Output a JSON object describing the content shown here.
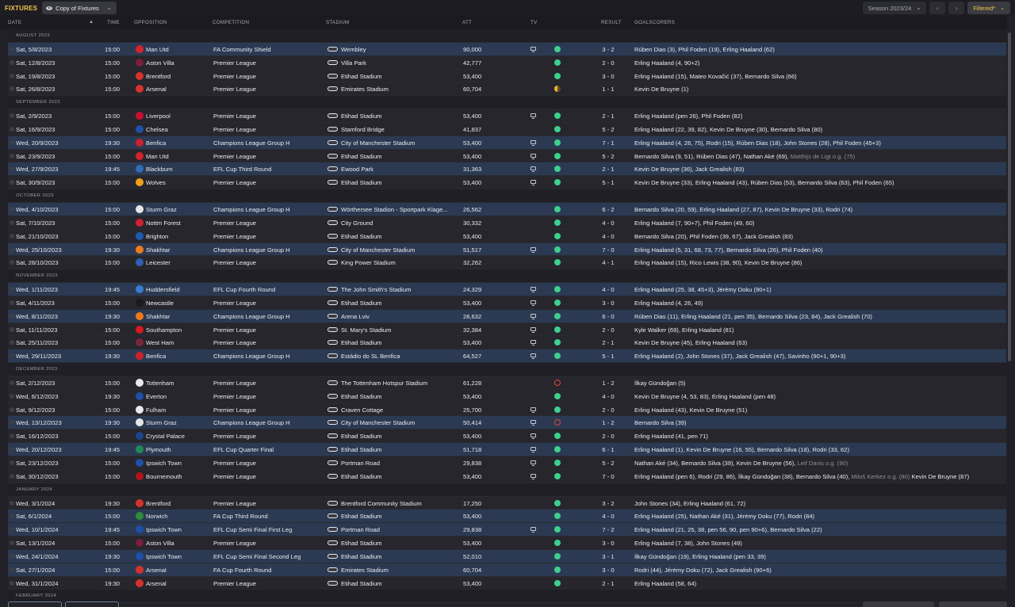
{
  "header": {
    "title": "FIXTURES",
    "view_label": "Copy of Fixtures",
    "season_label": "Season 2023/24",
    "filter_label": "Filtered*",
    "prev_icon": "chevron-left-icon",
    "next_icon": "chevron-right-icon"
  },
  "columns": {
    "date": "DATE",
    "time": "TIME",
    "opposition": "OPPOSITION",
    "competition": "COMPETITION",
    "stadium": "STADIUM",
    "att": "ATT",
    "tv": "TV",
    "result": "RESULT",
    "goalscorers": "GOALSCORERS"
  },
  "colors": {
    "accent": "#f2c744",
    "win": "#3ecf8e",
    "draw": "#f2b134",
    "loss": "#e0463e",
    "highlight_row": "#2b3a52"
  },
  "rows": [
    {
      "type": "month",
      "label": "AUGUST 2023"
    },
    {
      "type": "fixture",
      "date": "Sat, 5/8/2023",
      "time": "15:00",
      "opp": "Man Utd",
      "badge": "#d3242d",
      "comp": "FA Community Shield",
      "stadium": "Wembley",
      "att": "90,000",
      "tv": true,
      "status": "win",
      "result": "3 - 2",
      "scorers": "Rúben Dias (3), Phil Foden (19), Erling Haaland (62)",
      "hl": true
    },
    {
      "type": "fixture",
      "date": "Sat, 12/8/2023",
      "time": "15:00",
      "opp": "Aston Villa",
      "badge": "#7a1e3c",
      "comp": "Premier League",
      "stadium": "Villa Park",
      "att": "42,777",
      "tv": false,
      "status": "win",
      "result": "2 - 0",
      "scorers": "Erling Haaland (4, 90+2)"
    },
    {
      "type": "fixture",
      "date": "Sat, 19/8/2023",
      "time": "15:00",
      "opp": "Brentford",
      "badge": "#d6322c",
      "comp": "Premier League",
      "stadium": "Etihad Stadium",
      "att": "53,400",
      "tv": false,
      "status": "win",
      "result": "3 - 0",
      "scorers": "Erling Haaland (15), Mateo Kovačić (37), Bernardo Silva (66)"
    },
    {
      "type": "fixture",
      "date": "Sat, 26/8/2023",
      "time": "15:00",
      "opp": "Arsenal",
      "badge": "#d6322c",
      "comp": "Premier League",
      "stadium": "Emirates Stadium",
      "att": "60,704",
      "tv": false,
      "status": "draw",
      "result": "1 - 1",
      "scorers": "Kevin De Bruyne (1)"
    },
    {
      "type": "month",
      "label": "SEPTEMBER 2023"
    },
    {
      "type": "fixture",
      "date": "Sat, 2/9/2023",
      "time": "15:00",
      "opp": "Liverpool",
      "badge": "#c8102e",
      "comp": "Premier League",
      "stadium": "Etihad Stadium",
      "att": "53,400",
      "tv": true,
      "status": "win",
      "result": "2 - 1",
      "scorers": "Erling Haaland (pen 26), Phil Foden (82)"
    },
    {
      "type": "fixture",
      "date": "Sat, 16/9/2023",
      "time": "15:00",
      "opp": "Chelsea",
      "badge": "#1f4fa8",
      "comp": "Premier League",
      "stadium": "Stamford Bridge",
      "att": "41,837",
      "tv": false,
      "status": "win",
      "result": "5 - 2",
      "scorers": "Erling Haaland (22, 39, 82), Kevin De Bruyne (30), Bernardo Silva (80)"
    },
    {
      "type": "fixture",
      "date": "Wed, 20/9/2023",
      "time": "19:30",
      "opp": "Benfica",
      "badge": "#d0202e",
      "comp": "Champions League Group H",
      "stadium": "City of Manchester Stadium",
      "att": "53,400",
      "tv": true,
      "status": "win",
      "result": "7 - 1",
      "scorers": "Erling Haaland (4, 26, 75), Rodri (15), Rúben Dias (18), John Stones (28), Phil Foden (45+3)",
      "hl": true
    },
    {
      "type": "fixture",
      "date": "Sat, 23/9/2023",
      "time": "15:00",
      "opp": "Man Utd",
      "badge": "#d3242d",
      "comp": "Premier League",
      "stadium": "Etihad Stadium",
      "att": "53,400",
      "tv": true,
      "status": "win",
      "result": "5 - 2",
      "scorers": "Bernardo Silva (9, 51), Rúben Dias (47), Nathan Aké (69), ",
      "scorers_extra": "Matthijs de Ligt o.g. (75)"
    },
    {
      "type": "fixture",
      "date": "Wed, 27/9/2023",
      "time": "19:45",
      "opp": "Blackburn",
      "badge": "#2f6db5",
      "comp": "EFL Cup Third Round",
      "stadium": "Ewood Park",
      "att": "31,363",
      "tv": true,
      "status": "win",
      "result": "2 - 1",
      "scorers": "Kevin De Bruyne (36), Jack Grealish (83)",
      "hl": true
    },
    {
      "type": "fixture",
      "date": "Sat, 30/9/2023",
      "time": "15:00",
      "opp": "Wolves",
      "badge": "#f0a21a",
      "comp": "Premier League",
      "stadium": "Etihad Stadium",
      "att": "53,400",
      "tv": true,
      "status": "win",
      "result": "5 - 1",
      "scorers": "Kevin De Bruyne (33), Erling Haaland (43), Rúben Dias (53), Bernardo Silva (63), Phil Foden (65)"
    },
    {
      "type": "month",
      "label": "OCTOBER 2023"
    },
    {
      "type": "fixture",
      "date": "Wed, 4/10/2023",
      "time": "15:00",
      "opp": "Sturm Graz",
      "badge": "#e6e6e6",
      "comp": "Champions League Group H",
      "stadium": "Wörthersee Stadion - Sportpark Klage...",
      "att": "26,562",
      "tv": false,
      "status": "win",
      "result": "6 - 2",
      "scorers": "Bernardo Silva (20, 59), Erling Haaland (27, 87), Kevin De Bruyne (33), Rodri (74)",
      "hl": true
    },
    {
      "type": "fixture",
      "date": "Sat, 7/10/2023",
      "time": "15:00",
      "opp": "Nottm Forest",
      "badge": "#d0202e",
      "comp": "Premier League",
      "stadium": "City Ground",
      "att": "30,332",
      "tv": false,
      "status": "win",
      "result": "4 - 0",
      "scorers": "Erling Haaland (7, 90+7), Phil Foden (49, 60)"
    },
    {
      "type": "fixture",
      "date": "Sat, 21/10/2023",
      "time": "15:00",
      "opp": "Brighton",
      "badge": "#1e5cb3",
      "comp": "Premier League",
      "stadium": "Etihad Stadium",
      "att": "53,400",
      "tv": false,
      "status": "win",
      "result": "4 - 0",
      "scorers": "Bernardo Silva (20), Phil Foden (39, 67), Jack Grealish (83)"
    },
    {
      "type": "fixture",
      "date": "Wed, 25/10/2023",
      "time": "19:30",
      "opp": "Shakhtar",
      "badge": "#f07a1a",
      "comp": "Champions League Group H",
      "stadium": "City of Manchester Stadium",
      "att": "51,517",
      "tv": true,
      "status": "win",
      "result": "7 - 0",
      "scorers": "Erling Haaland (5, 31, 68, 73, 77), Bernardo Silva (26), Phil Foden (40)",
      "hl": true
    },
    {
      "type": "fixture",
      "date": "Sat, 28/10/2023",
      "time": "15:00",
      "opp": "Leicester",
      "badge": "#2f5fb5",
      "comp": "Premier League",
      "stadium": "King Power Stadium",
      "att": "32,262",
      "tv": false,
      "status": "win",
      "result": "4 - 1",
      "scorers": "Erling Haaland (15), Rico Lewis (38, 90), Kevin De Bruyne (86)"
    },
    {
      "type": "month",
      "label": "NOVEMBER 2023"
    },
    {
      "type": "fixture",
      "date": "Wed, 1/11/2023",
      "time": "19:45",
      "opp": "Huddersfield",
      "badge": "#3a7bd5",
      "comp": "EFL Cup Fourth Round",
      "stadium": "The John Smith's Stadium",
      "att": "24,329",
      "tv": true,
      "status": "win",
      "result": "4 - 0",
      "scorers": "Erling Haaland (25, 38, 45+3), Jérémy Doku (90+1)",
      "hl": true
    },
    {
      "type": "fixture",
      "date": "Sat, 4/11/2023",
      "time": "15:00",
      "opp": "Newcastle",
      "badge": "#1b1b1b",
      "comp": "Premier League",
      "stadium": "Etihad Stadium",
      "att": "53,400",
      "tv": true,
      "status": "win",
      "result": "3 - 0",
      "scorers": "Erling Haaland (4, 26, 49)"
    },
    {
      "type": "fixture",
      "date": "Wed, 8/11/2023",
      "time": "19:30",
      "opp": "Shakhtar",
      "badge": "#f07a1a",
      "comp": "Champions League Group H",
      "stadium": "Arena Lviv",
      "att": "28,632",
      "tv": true,
      "status": "win",
      "result": "6 - 0",
      "scorers": "Rúben Dias (11), Erling Haaland (21, pen 35), Bernardo Silva (23, 84), Jack Grealish (70)",
      "hl": true
    },
    {
      "type": "fixture",
      "date": "Sat, 11/11/2023",
      "time": "15:00",
      "opp": "Southampton",
      "badge": "#d71920",
      "comp": "Premier League",
      "stadium": "St. Mary's Stadium",
      "att": "32,384",
      "tv": true,
      "status": "win",
      "result": "2 - 0",
      "scorers": "Kyle Walker (69), Erling Haaland (81)"
    },
    {
      "type": "fixture",
      "date": "Sat, 25/11/2023",
      "time": "15:00",
      "opp": "West Ham",
      "badge": "#7a263a",
      "comp": "Premier League",
      "stadium": "Etihad Stadium",
      "att": "53,400",
      "tv": true,
      "status": "win",
      "result": "2 - 1",
      "scorers": "Kevin De Bruyne (45), Erling Haaland (63)"
    },
    {
      "type": "fixture",
      "date": "Wed, 29/11/2023",
      "time": "19:30",
      "opp": "Benfica",
      "badge": "#d0202e",
      "comp": "Champions League Group H",
      "stadium": "Estádio do SL Benfica",
      "att": "64,527",
      "tv": true,
      "status": "win",
      "result": "5 - 1",
      "scorers": "Erling Haaland (2), John Stones (37), Jack Grealish (47), Savinho (90+1, 90+3)",
      "hl": true
    },
    {
      "type": "month",
      "label": "DECEMBER 2023"
    },
    {
      "type": "fixture",
      "date": "Sat, 2/12/2023",
      "time": "15:00",
      "opp": "Tottenham",
      "badge": "#e8e8ee",
      "comp": "Premier League",
      "stadium": "The Tottenham Hotspur Stadium",
      "att": "61,228",
      "tv": false,
      "status": "loss",
      "result": "1 - 2",
      "scorers": "İlkay Gündoğan (5)"
    },
    {
      "type": "fixture",
      "date": "Wed, 6/12/2023",
      "time": "19:30",
      "opp": "Everton",
      "badge": "#1f4fa8",
      "comp": "Premier League",
      "stadium": "Etihad Stadium",
      "att": "53,400",
      "tv": false,
      "status": "win",
      "result": "4 - 0",
      "scorers": "Kevin De Bruyne (4, 53, 83), Erling Haaland (pen 48)"
    },
    {
      "type": "fixture",
      "date": "Sat, 9/12/2023",
      "time": "15:00",
      "opp": "Fulham",
      "badge": "#e8e8ee",
      "comp": "Premier League",
      "stadium": "Craven Cottage",
      "att": "25,700",
      "tv": true,
      "status": "win",
      "result": "2 - 0",
      "scorers": "Erling Haaland (43), Kevin De Bruyne (51)"
    },
    {
      "type": "fixture",
      "date": "Wed, 13/12/2023",
      "time": "19:30",
      "opp": "Sturm Graz",
      "badge": "#e6e6e6",
      "comp": "Champions League Group H",
      "stadium": "City of Manchester Stadium",
      "att": "50,414",
      "tv": true,
      "status": "loss",
      "result": "1 - 2",
      "scorers": "Bernardo Silva (39)",
      "hl": true
    },
    {
      "type": "fixture",
      "date": "Sat, 16/12/2023",
      "time": "15:00",
      "opp": "Crystal Palace",
      "badge": "#1b458f",
      "comp": "Premier League",
      "stadium": "Etihad Stadium",
      "att": "53,400",
      "tv": true,
      "status": "win",
      "result": "2 - 0",
      "scorers": "Erling Haaland (41, pen 71)"
    },
    {
      "type": "fixture",
      "date": "Wed, 20/12/2023",
      "time": "19:45",
      "opp": "Plymouth",
      "badge": "#1f8a5a",
      "comp": "EFL Cup Quarter Final",
      "stadium": "Etihad Stadium",
      "att": "51,718",
      "tv": true,
      "status": "win",
      "result": "6 - 1",
      "scorers": "Erling Haaland (1), Kevin De Bruyne (16, 55), Bernardo Silva (18), Rodri (33, 62)",
      "hl": true
    },
    {
      "type": "fixture",
      "date": "Sat, 23/12/2023",
      "time": "15:00",
      "opp": "Ipswich Town",
      "badge": "#1f4fa8",
      "comp": "Premier League",
      "stadium": "Portman Road",
      "att": "29,838",
      "tv": true,
      "status": "win",
      "result": "5 - 2",
      "scorers": "Nathan Aké (34), Bernardo Silva (39), Kevin De Bruyne (56), ",
      "scorers_extra": "Leif Davis o.g. (90)"
    },
    {
      "type": "fixture",
      "date": "Sat, 30/12/2023",
      "time": "15:00",
      "opp": "Bournemouth",
      "badge": "#b5141c",
      "comp": "Premier League",
      "stadium": "Etihad Stadium",
      "att": "53,400",
      "tv": true,
      "status": "win",
      "result": "7 - 0",
      "scorers": "Erling Haaland (pen 6), Rodri (29, 86), İlkay Gündoğan (38), Bernardo Silva (40), ",
      "scorers_extra": "Miloš Kerkez o.g. (80)",
      "scorers_tail": " Kevin De Bruyne (87)"
    },
    {
      "type": "month",
      "label": "JANUARY 2024"
    },
    {
      "type": "fixture",
      "date": "Wed, 3/1/2024",
      "time": "19:30",
      "opp": "Brentford",
      "badge": "#d6322c",
      "comp": "Premier League",
      "stadium": "Brentford Community Stadium",
      "att": "17,250",
      "tv": false,
      "status": "win",
      "result": "3 - 2",
      "scorers": "John Stones (34), Erling Haaland (61, 72)"
    },
    {
      "type": "fixture",
      "date": "Sat, 6/1/2024",
      "time": "15:00",
      "opp": "Norwich",
      "badge": "#2e8b3c",
      "comp": "FA Cup Third Round",
      "stadium": "Etihad Stadium",
      "att": "53,400",
      "tv": false,
      "status": "win",
      "result": "4 - 0",
      "scorers": "Erling Haaland (25), Nathan Aké (31), Jérémy Doku (77), Rodri (84)",
      "hl": true
    },
    {
      "type": "fixture",
      "date": "Wed, 10/1/2024",
      "time": "19:45",
      "opp": "Ipswich Town",
      "badge": "#1f4fa8",
      "comp": "EFL Cup Semi Final First Leg",
      "stadium": "Portman Road",
      "att": "29,838",
      "tv": true,
      "status": "win",
      "result": "7 - 2",
      "scorers": "Erling Haaland (21, 25, 38, pen 56, 90, pen 90+6), Bernardo Silva (22)",
      "hl": true
    },
    {
      "type": "fixture",
      "date": "Sat, 13/1/2024",
      "time": "15:00",
      "opp": "Aston Villa",
      "badge": "#7a1e3c",
      "comp": "Premier League",
      "stadium": "Etihad Stadium",
      "att": "53,400",
      "tv": false,
      "status": "win",
      "result": "3 - 0",
      "scorers": "Erling Haaland (7, 38), John Stones (49)"
    },
    {
      "type": "fixture",
      "date": "Wed, 24/1/2024",
      "time": "19:30",
      "opp": "Ipswich Town",
      "badge": "#1f4fa8",
      "comp": "EFL Cup Semi Final Second Leg",
      "stadium": "Etihad Stadium",
      "att": "52,010",
      "tv": false,
      "status": "win",
      "result": "3 - 1",
      "scorers": "İlkay Gündoğan (19), Erling Haaland (pen 33, 39)",
      "hl": true
    },
    {
      "type": "fixture",
      "date": "Sat, 27/1/2024",
      "time": "15:00",
      "opp": "Arsenal",
      "badge": "#d6322c",
      "comp": "FA Cup Fourth Round",
      "stadium": "Emirates Stadium",
      "att": "60,704",
      "tv": false,
      "status": "win",
      "result": "3 - 0",
      "scorers": "Rodri (44), Jérémy Doku (72), Jack Grealish (90+6)",
      "hl": true
    },
    {
      "type": "fixture",
      "date": "Wed, 31/1/2024",
      "time": "19:30",
      "opp": "Arsenal",
      "badge": "#d6322c",
      "comp": "Premier League",
      "stadium": "Etihad Stadium",
      "att": "53,400",
      "tv": false,
      "status": "win",
      "result": "2 - 1",
      "scorers": "Erling Haaland (58, 64)"
    },
    {
      "type": "month",
      "label": "FEBRUARY 2024"
    }
  ]
}
